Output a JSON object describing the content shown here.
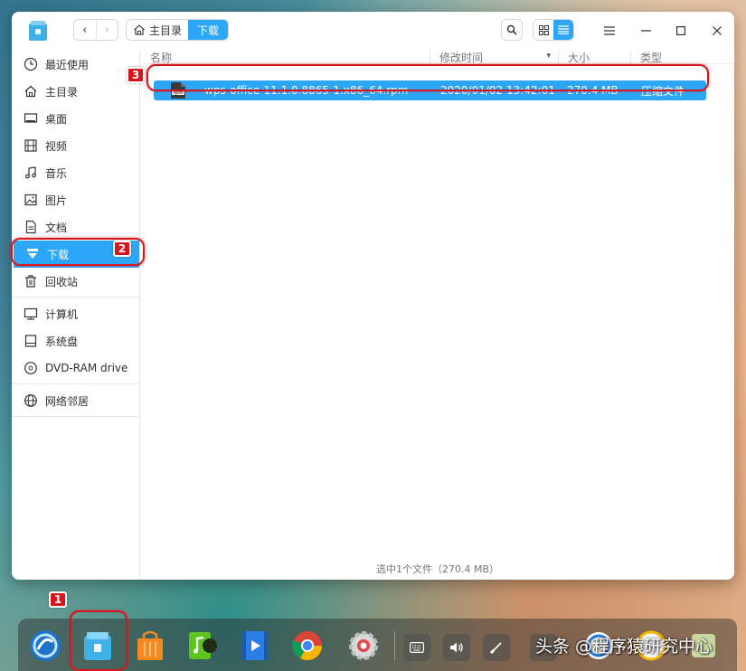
{
  "breadcrumb": {
    "home": "主目录",
    "current": "下载"
  },
  "sidebar": {
    "items": [
      {
        "label": "最近使用",
        "icon": "clock-icon"
      },
      {
        "label": "主目录",
        "icon": "home-icon"
      },
      {
        "label": "桌面",
        "icon": "desktop-icon"
      },
      {
        "label": "视频",
        "icon": "film-icon"
      },
      {
        "label": "音乐",
        "icon": "music-icon"
      },
      {
        "label": "图片",
        "icon": "image-icon"
      },
      {
        "label": "文档",
        "icon": "document-icon"
      },
      {
        "label": "下载",
        "icon": "download-icon",
        "active": true
      },
      {
        "label": "回收站",
        "icon": "trash-icon"
      }
    ],
    "devices": [
      {
        "label": "计算机",
        "icon": "computer-icon"
      },
      {
        "label": "系统盘",
        "icon": "disk-icon"
      },
      {
        "label": "DVD-RAM drive",
        "icon": "dvd-icon"
      }
    ],
    "network": [
      {
        "label": "网络邻居",
        "icon": "network-icon"
      }
    ]
  },
  "columns": {
    "name": "名称",
    "date": "修改时间",
    "size": "大小",
    "type": "类型"
  },
  "files": [
    {
      "name": "wps-office-11.1.0.8865-1.x86_64.rpm",
      "date": "2020/01/02 13:42:01",
      "size": "270.4 MB",
      "type": "压缩文件",
      "icon_text": "rpm",
      "selected": true
    }
  ],
  "status": "选中1个文件（270.4 MB）",
  "annotations": {
    "dock": "1",
    "sidebar": "2",
    "file": "3"
  },
  "watermark": "头条 @程序猿研究中心",
  "colors": {
    "accent": "#2ca7f8",
    "highlight": "#d7161b"
  }
}
